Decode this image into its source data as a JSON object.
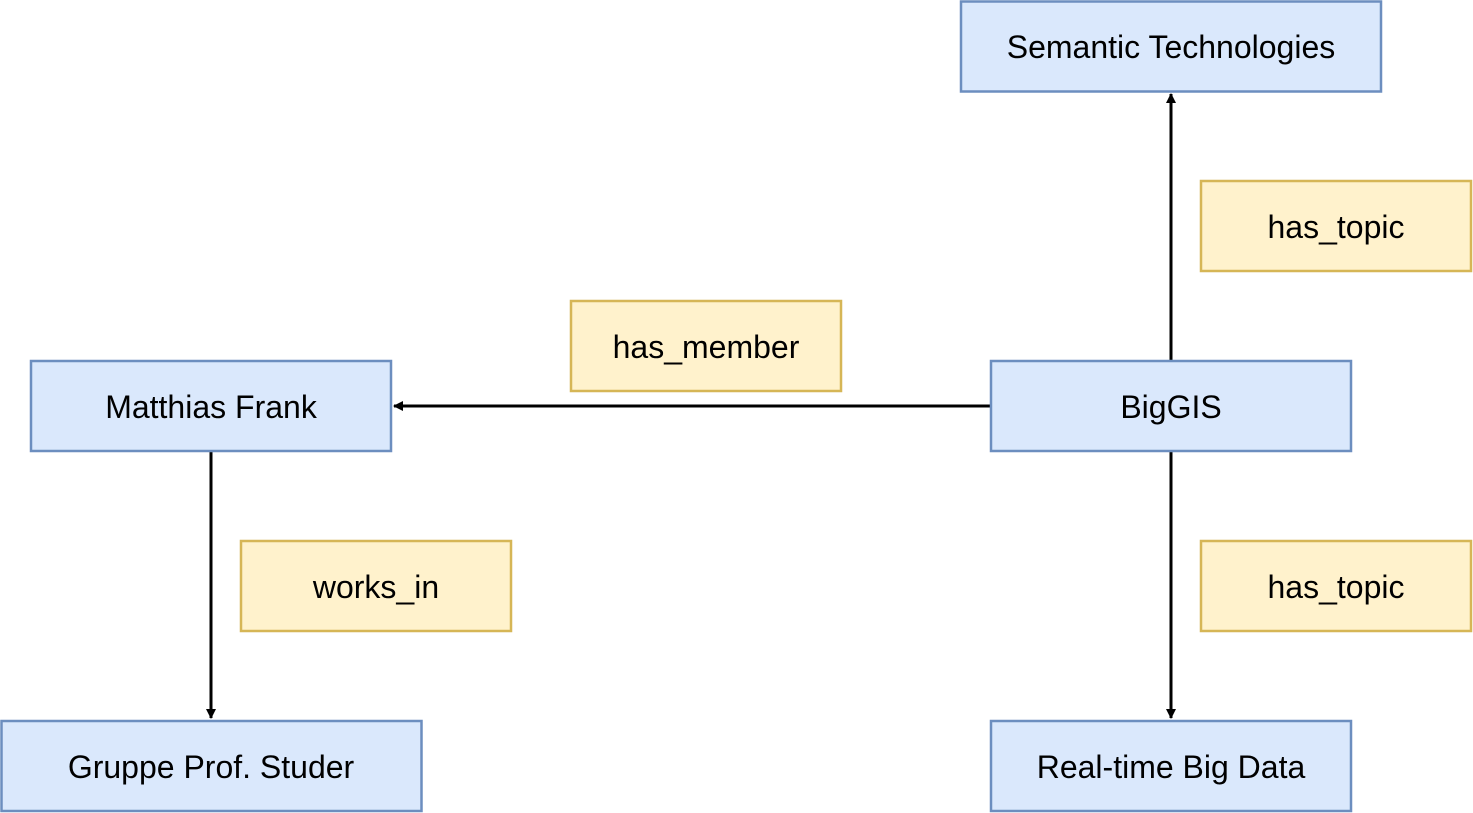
{
  "colors": {
    "entity_fill": "#dae8fc",
    "entity_stroke": "#6c8ebf",
    "relation_fill": "#fff2cc",
    "relation_stroke": "#d6b656",
    "edge": "#000000"
  },
  "nodes": {
    "semantic_technologies": "Semantic Technologies",
    "matthias_frank": "Matthias Frank",
    "biggis": "BigGIS",
    "gruppe_studer": "Gruppe Prof. Studer",
    "realtime_big_data": "Real-time Big Data"
  },
  "relations": {
    "has_topic_top": "has_topic",
    "has_member": "has_member",
    "works_in": "works_in",
    "has_topic_bottom": "has_topic"
  },
  "edges": [
    {
      "from": "BigGIS",
      "to": "Semantic Technologies",
      "label": "has_topic"
    },
    {
      "from": "BigGIS",
      "to": "Matthias Frank",
      "label": "has_member"
    },
    {
      "from": "Matthias Frank",
      "to": "Gruppe Prof. Studer",
      "label": "works_in"
    },
    {
      "from": "BigGIS",
      "to": "Real-time Big Data",
      "label": "has_topic"
    }
  ]
}
